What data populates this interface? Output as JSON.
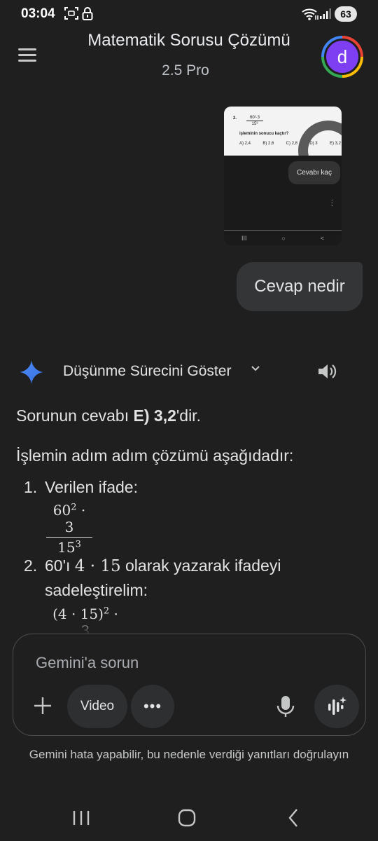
{
  "status": {
    "time": "03:04",
    "battery": "63"
  },
  "header": {
    "title": "Matematik Sorusu Çözümü",
    "model": "2.5 Pro",
    "avatar_letter": "d"
  },
  "attachment": {
    "question_number": "2.",
    "fraction_numerator": "60²·3",
    "fraction_denominator": "15³",
    "question_text": "işleminin sonucu kaçtır?",
    "options": [
      "A) 2,4",
      "B) 2,6",
      "C) 2,8",
      "D) 3",
      "E) 3,2"
    ],
    "bubble_text": "Cevabı kaç"
  },
  "user_message": "Cevap nedir",
  "thinking_label": "Düşünme Sürecini Göster",
  "answer": {
    "intro_prefix": "Sorunun cevabı ",
    "intro_bold": "E) 3,2",
    "intro_suffix": "'dir.",
    "steps_intro": "İşlemin adım adım çözümü aşağıdadır:",
    "step1_num": "1.",
    "step1_text": "Verilen ifade:",
    "step2_num": "2.",
    "step2_prefix": "60'ı ",
    "step2_math": "4 · 15",
    "step2_suffix": " olarak yazarak ifadeyi",
    "step2_line2": "sadeleştirelim:",
    "step2_numerator": "(4 · 15)"
  },
  "input": {
    "placeholder": "Gemini'a sorun",
    "video_label": "Video",
    "more_label": "•••"
  },
  "disclaimer": "Gemini hata yapabilir, bu nedenle verdiği yanıtları doğrulayın",
  "colors": {
    "background": "#1f1f1f",
    "bubble": "#333537",
    "avatar": "#7e3ff2",
    "sparkle": "#4a8cf7"
  }
}
